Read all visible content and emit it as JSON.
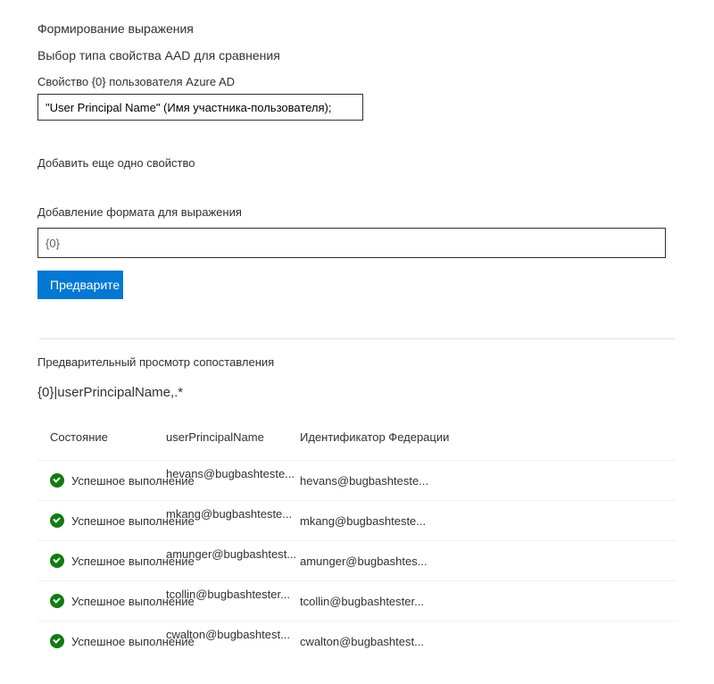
{
  "header": {
    "title": "Формирование выражения",
    "subtitle": "Выбор типа свойства AAD для сравнения"
  },
  "property": {
    "label": "Свойство {0} пользователя Azure AD",
    "value": "\"User Principal Name\" (Имя участника-пользователя);"
  },
  "addProperty": {
    "label": "Добавить еще одно свойство"
  },
  "format": {
    "label": "Добавление формата для выражения",
    "value": "{0}"
  },
  "previewButton": {
    "label": "Предварите"
  },
  "preview": {
    "header": "Предварительный просмотр сопоставления",
    "pattern": "{0}|userPrincipalName,.*"
  },
  "table": {
    "headers": {
      "status": "Состояние",
      "upn": "userPrincipalName",
      "federation": "Идентификатор Федерации"
    },
    "statusLabel": "Успешное выполнение",
    "rows": [
      {
        "upn": "hevans@bugbashteste...",
        "fed": "hevans@bugbashteste..."
      },
      {
        "upn": "mkang@bugbashteste...",
        "fed": "mkang@bugbashteste..."
      },
      {
        "upn": "amunger@bugbashtest...",
        "fed": "amunger@bugbashtes..."
      },
      {
        "upn": "tcollin@bugbashtester...",
        "fed": "tcollin@bugbashtester..."
      },
      {
        "upn": "cwalton@bugbashtest...",
        "fed": "cwalton@bugbashtest..."
      }
    ]
  }
}
